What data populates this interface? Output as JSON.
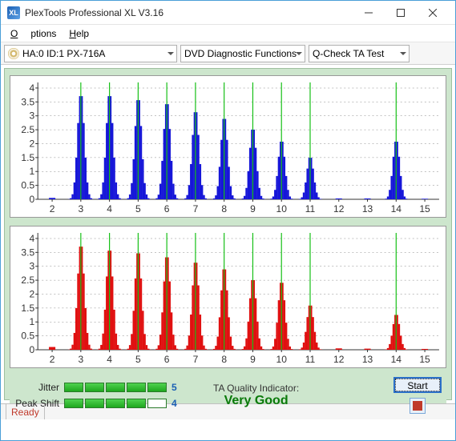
{
  "window": {
    "title": "PlexTools Professional XL V3.16",
    "logo_text": "XL"
  },
  "menu": {
    "options": "Options",
    "help": "Help"
  },
  "toolbar": {
    "drive": "HA:0 ID:1  PX-716A",
    "diag": "DVD Diagnostic Functions",
    "test": "Q-Check TA Test"
  },
  "chart_data": [
    {
      "type": "bar",
      "color": "#1616d8",
      "xlim": [
        1.5,
        15.5
      ],
      "ylim": [
        0,
        4.2
      ],
      "xticks": [
        2,
        3,
        4,
        5,
        6,
        7,
        8,
        9,
        10,
        11,
        12,
        13,
        14,
        15
      ],
      "yticks": [
        0,
        0.5,
        1,
        1.5,
        2,
        2.5,
        3,
        3.5,
        4
      ],
      "peaks": [
        {
          "center": 3,
          "height": 3.85
        },
        {
          "center": 4,
          "height": 3.85
        },
        {
          "center": 5,
          "height": 3.7
        },
        {
          "center": 6,
          "height": 3.55
        },
        {
          "center": 7,
          "height": 3.25
        },
        {
          "center": 8,
          "height": 3.0
        },
        {
          "center": 9,
          "height": 2.6
        },
        {
          "center": 10,
          "height": 2.15
        },
        {
          "center": 11,
          "height": 1.55
        },
        {
          "center": 14,
          "height": 2.15
        }
      ],
      "baseline_noise": [
        {
          "x": 2,
          "h": 0.05
        },
        {
          "x": 12,
          "h": 0.03
        },
        {
          "x": 13,
          "h": 0.03
        },
        {
          "x": 15,
          "h": 0.02
        }
      ]
    },
    {
      "type": "bar",
      "color": "#e01010",
      "xlim": [
        1.5,
        15.5
      ],
      "ylim": [
        0,
        4.2
      ],
      "xticks": [
        2,
        3,
        4,
        5,
        6,
        7,
        8,
        9,
        10,
        11,
        12,
        13,
        14,
        15
      ],
      "yticks": [
        0,
        0.5,
        1,
        1.5,
        2,
        2.5,
        3,
        3.5,
        4
      ],
      "peaks": [
        {
          "center": 3,
          "height": 3.85
        },
        {
          "center": 4,
          "height": 3.7
        },
        {
          "center": 5,
          "height": 3.6
        },
        {
          "center": 6,
          "height": 3.45
        },
        {
          "center": 7,
          "height": 3.25
        },
        {
          "center": 8,
          "height": 3.0
        },
        {
          "center": 9,
          "height": 2.6
        },
        {
          "center": 10,
          "height": 2.5
        },
        {
          "center": 11,
          "height": 1.65
        },
        {
          "center": 14,
          "height": 1.3
        }
      ],
      "baseline_noise": [
        {
          "x": 2,
          "h": 0.1
        },
        {
          "x": 12,
          "h": 0.05
        },
        {
          "x": 13,
          "h": 0.04
        },
        {
          "x": 15,
          "h": 0.03
        }
      ]
    }
  ],
  "metrics": {
    "jitter_label": "Jitter",
    "jitter_bars": 5,
    "jitter_value": "5",
    "peakshift_label": "Peak Shift",
    "peakshift_bars": 4,
    "peakshift_value": "4",
    "ta_label": "TA Quality Indicator:",
    "ta_value": "Very Good",
    "start": "Start"
  },
  "status": {
    "text": "Ready"
  }
}
